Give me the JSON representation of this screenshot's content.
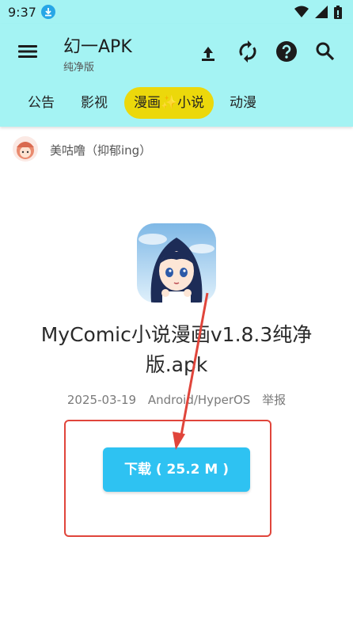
{
  "status_bar": {
    "time": "9:37"
  },
  "app_bar": {
    "title": "幻一APK",
    "subtitle": "纯净版"
  },
  "tabs": [
    {
      "label": "公告"
    },
    {
      "label": "影视"
    },
    {
      "label": "漫画✨小说",
      "active": true
    },
    {
      "label": "动漫"
    }
  ],
  "post": {
    "author": "美咕噜（抑郁ing）",
    "file_title": "MyComic小说漫画v1.8.3纯净版.apk",
    "date": "2025-03-19",
    "platform": "Android/HyperOS",
    "report_label": "举报",
    "download_label": "下载 ( 25.2 M )"
  },
  "colors": {
    "app_bar_bg": "#a4f3f3",
    "active_tab": "#ecd80b",
    "download_button": "#2ec2f2",
    "annotation": "#e0453b"
  },
  "icons": [
    "menu-icon",
    "upload-icon",
    "refresh-icon",
    "help-icon",
    "search-icon",
    "download-status-icon",
    "wifi-icon",
    "signal-icon",
    "battery-icon"
  ]
}
